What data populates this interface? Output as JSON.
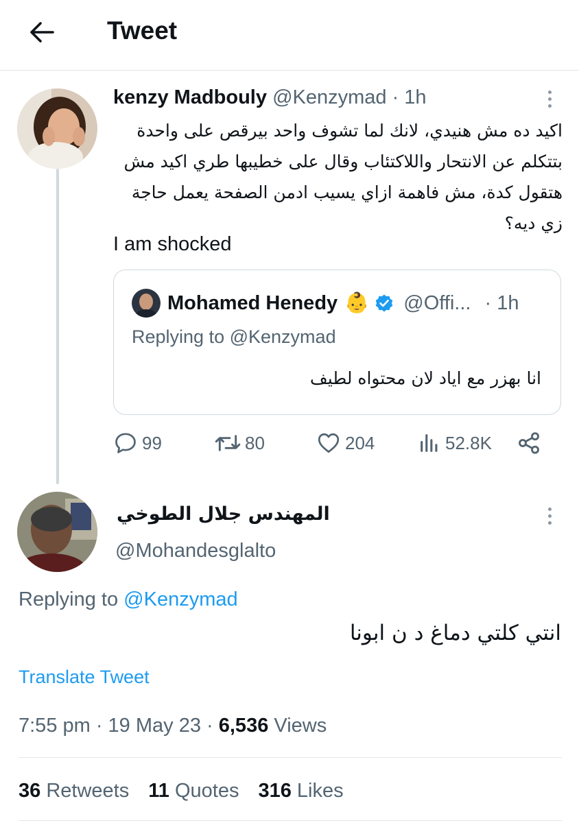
{
  "header": {
    "title": "Tweet"
  },
  "tweet": {
    "author_name": "kenzy Madbouly",
    "author_handle": "@Kenzymad",
    "time": "· 1h",
    "text_ar": "اكيد ده مش هنيدي، لانك لما تشوف واحد بيرقص على واحدة بتتكلم عن الانتحار واللاكتئاب وقال على خطيبها طري اكيد مش هتقول كدة، مش فاهمة ازاي يسيب ادمن الصفحة يعمل حاجة زي ديه؟",
    "text_en": "I am shocked",
    "quote": {
      "author_name": "Mohamed Henedy",
      "emoji": "👶",
      "author_handle": "@Offi...",
      "time": "· 1h",
      "replying_prefix": "Replying to",
      "replying_handle": "@Kenzymad",
      "text": "انا بهزر مع اياد لان محتواه لطيف"
    },
    "actions": {
      "replies": "99",
      "retweets": "80",
      "likes": "204",
      "views": "52.8K"
    }
  },
  "reply": {
    "author_name": "المهندس جلال الطوخي",
    "author_handle": "@Mohandesglalto",
    "replying_prefix": "Replying to",
    "replying_handle": "@Kenzymad",
    "text": "انتي كلتي دماغ د ن ابونا",
    "translate_label": "Translate Tweet",
    "timestamp": "7:55 pm · 19 May 23 ·",
    "views_count": "6,536",
    "views_label": "Views",
    "stats": {
      "retweets_count": "36",
      "retweets_label": "Retweets",
      "quotes_count": "11",
      "quotes_label": "Quotes",
      "likes_count": "316",
      "likes_label": "Likes"
    }
  },
  "colors": {
    "accent": "#1d9bf0",
    "muted": "#536471",
    "text": "#0f1419",
    "divider": "#e1e6ea"
  }
}
